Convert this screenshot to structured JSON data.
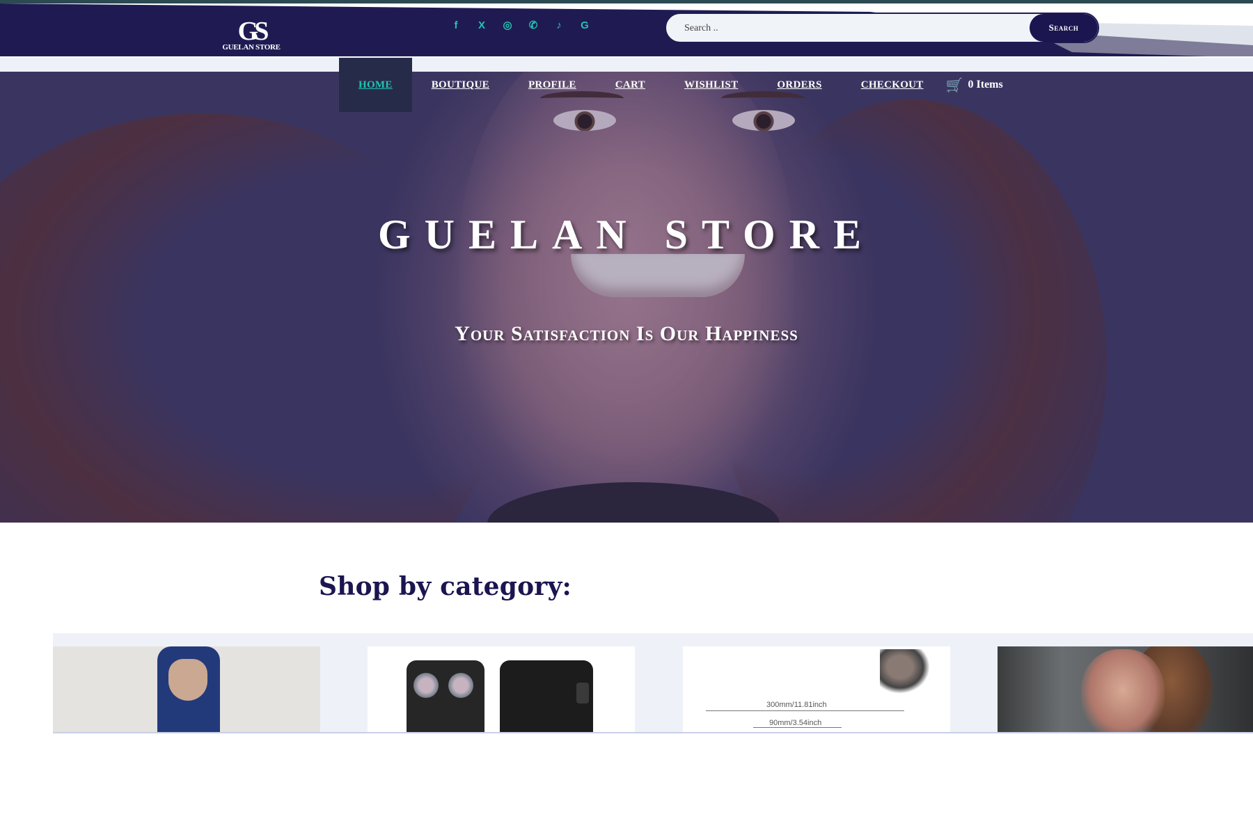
{
  "brand": {
    "logo_mark": "GS",
    "logo_text": "GUELAN STORE"
  },
  "socials": [
    {
      "name": "facebook-icon",
      "glyph": "f"
    },
    {
      "name": "x-twitter-icon",
      "glyph": "X"
    },
    {
      "name": "instagram-icon",
      "glyph": "◎"
    },
    {
      "name": "whatsapp-icon",
      "glyph": "✆"
    },
    {
      "name": "tiktok-icon",
      "glyph": "♪"
    },
    {
      "name": "google-icon",
      "glyph": "G"
    }
  ],
  "search": {
    "placeholder": "Search ..",
    "value": "",
    "button_label": "Search"
  },
  "nav": {
    "items": [
      "HOME",
      "BOUTIQUE",
      "PROFILE",
      "CART",
      "WISHLIST",
      "ORDERS",
      "CHECKOUT"
    ],
    "active": "HOME",
    "cart_label": "0 Items",
    "cart_icon": "cart-icon"
  },
  "hero": {
    "title": "GUELAN STORE",
    "subtitle": "Your Satisfaction Is Our Happiness"
  },
  "shop": {
    "heading": "Shop by category:",
    "categories": [
      {
        "image": "activewear-back-photo"
      },
      {
        "image": "smartphones-photo"
      },
      {
        "image": "ab-roller-diagram",
        "dim1": "300mm/11.81inch",
        "dim2": "90mm/3.54inch"
      },
      {
        "image": "woman-portrait-photo"
      }
    ]
  },
  "colors": {
    "navy": "#1b1550",
    "teal": "#23c3b4",
    "page_bg": "#ffffff",
    "band_bg": "#eef2f8"
  }
}
